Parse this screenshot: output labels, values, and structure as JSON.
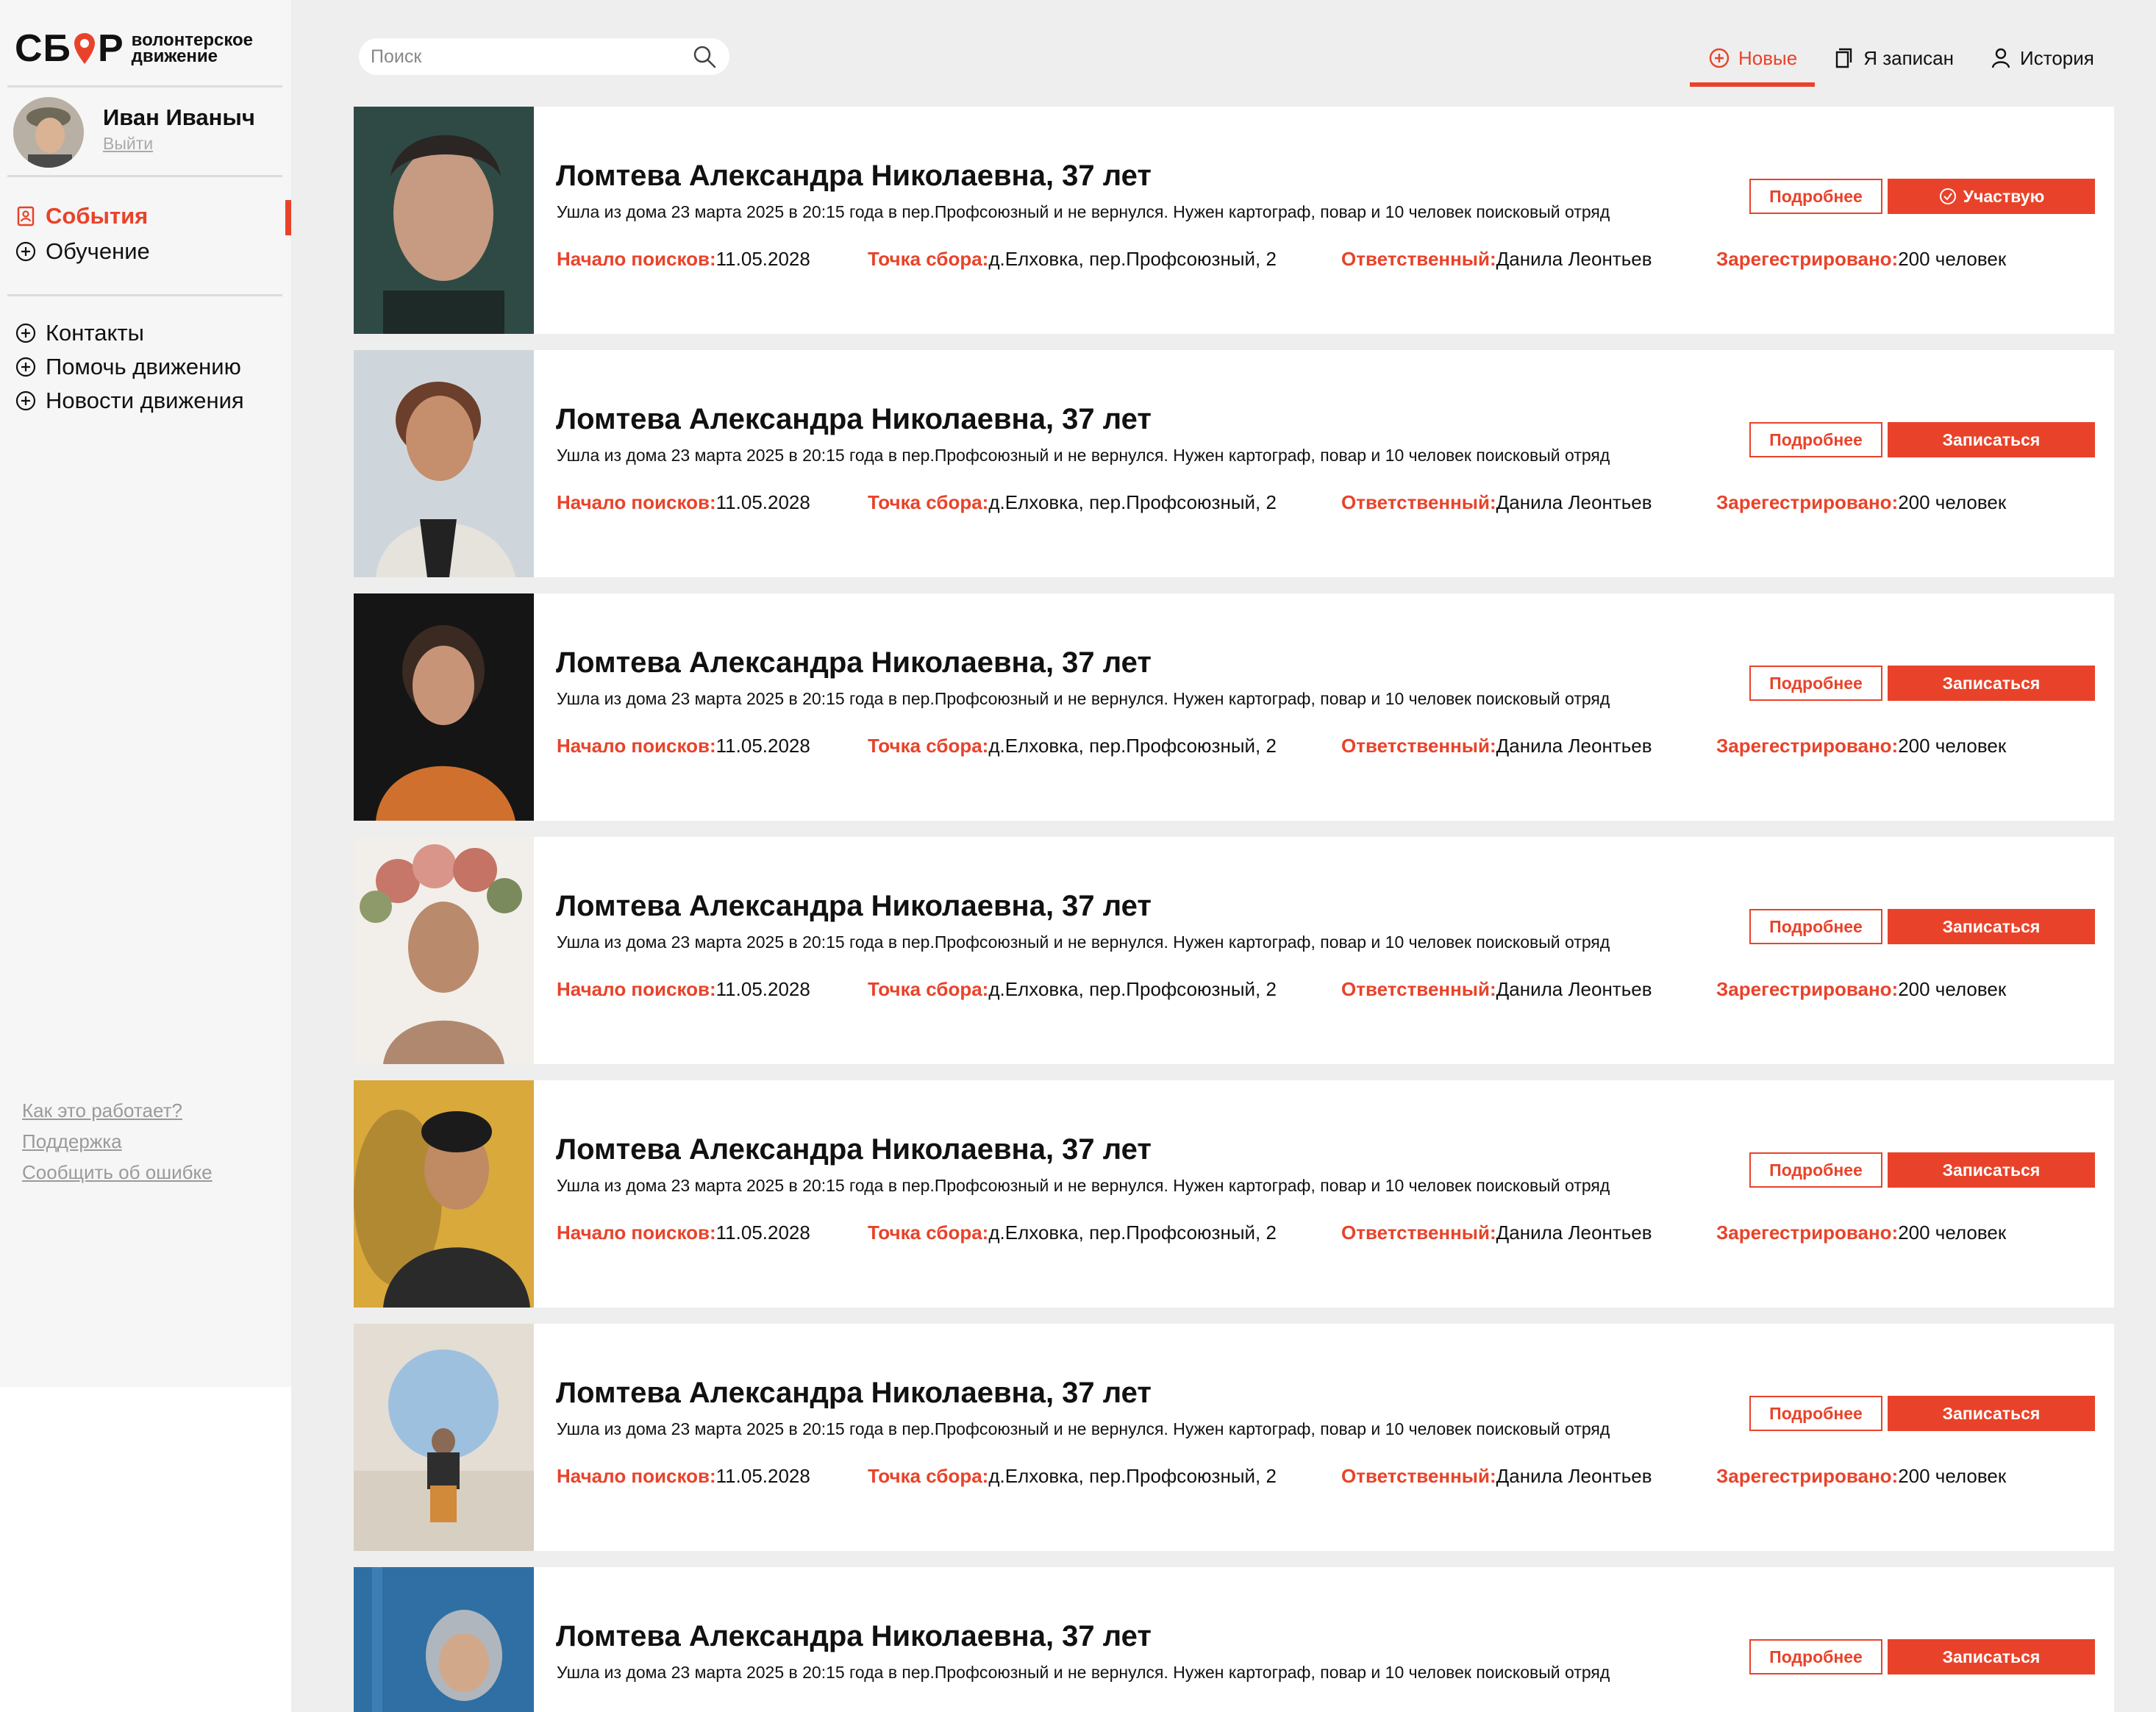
{
  "brand": {
    "logo_left": "СБ",
    "logo_right": "Р",
    "logo_sub_1": "волонтерское",
    "logo_sub_2": "движение",
    "accent": "#e8432a"
  },
  "user": {
    "name": "Иван Иваныч",
    "logout": "Выйти"
  },
  "nav_main": [
    {
      "label": "События",
      "icon": "events-icon",
      "active": true
    },
    {
      "label": "Обучение",
      "icon": "plus-circle-icon",
      "active": false
    }
  ],
  "nav_secondary": [
    {
      "label": "Контакты",
      "icon": "plus-circle-icon"
    },
    {
      "label": "Помочь движению",
      "icon": "plus-circle-icon"
    },
    {
      "label": "Новости движения",
      "icon": "plus-circle-icon"
    }
  ],
  "footer_links": [
    "Как это работает?",
    "Поддержка",
    "Сообщить об ошибке"
  ],
  "search": {
    "placeholder": "Поиск"
  },
  "tabs": [
    {
      "label": "Новые",
      "icon": "plus-circle-icon",
      "active": true
    },
    {
      "label": "Я записан",
      "icon": "document-icon",
      "active": false
    },
    {
      "label": "История",
      "icon": "user-icon",
      "active": false
    }
  ],
  "labels": {
    "start": "Начало поисков:",
    "point": "Точка сбора:",
    "responsible": "Ответственный:",
    "registered": "Зарегестрировано:",
    "more": "Подробнее",
    "join": "Записаться",
    "joined": "Участвую"
  },
  "cards": [
    {
      "title": "Ломтева Александра Николаевна, 37 лет",
      "desc": "Ушла из дома 23 марта 2025 в 20:15 года в пер.Профсоюзный и не вернулся. Нужен картограф, повар и 10 человек поисковый отряд",
      "start": "11.05.2028",
      "point": "д.Елховка, пер.Профсоюзный, 2",
      "responsible": "Данила Леонтьев",
      "registered": "200 человек",
      "status": "joined"
    },
    {
      "title": "Ломтева Александра Николаевна, 37 лет",
      "desc": "Ушла из дома 23 марта 2025 в 20:15 года в пер.Профсоюзный и не вернулся. Нужен картограф, повар и 10 человек поисковый отряд",
      "start": "11.05.2028",
      "point": "д.Елховка, пер.Профсоюзный, 2",
      "responsible": "Данила Леонтьев",
      "registered": "200 человек",
      "status": "join"
    },
    {
      "title": "Ломтева Александра Николаевна, 37 лет",
      "desc": "Ушла из дома 23 марта 2025 в 20:15 года в пер.Профсоюзный и не вернулся. Нужен картограф, повар и 10 человек поисковый отряд",
      "start": "11.05.2028",
      "point": "д.Елховка, пер.Профсоюзный, 2",
      "responsible": "Данила Леонтьев",
      "registered": "200 человек",
      "status": "join"
    },
    {
      "title": "Ломтева Александра Николаевна, 37 лет",
      "desc": "Ушла из дома 23 марта 2025 в 20:15 года в пер.Профсоюзный и не вернулся. Нужен картограф, повар и 10 человек поисковый отряд",
      "start": "11.05.2028",
      "point": "д.Елховка, пер.Профсоюзный, 2",
      "responsible": "Данила Леонтьев",
      "registered": "200 человек",
      "status": "join"
    },
    {
      "title": "Ломтева Александра Николаевна, 37 лет",
      "desc": "Ушла из дома 23 марта 2025 в 20:15 года в пер.Профсоюзный и не вернулся. Нужен картограф, повар и 10 человек поисковый отряд",
      "start": "11.05.2028",
      "point": "д.Елховка, пер.Профсоюзный, 2",
      "responsible": "Данила Леонтьев",
      "registered": "200 человек",
      "status": "join"
    },
    {
      "title": "Ломтева Александра Николаевна, 37 лет",
      "desc": "Ушла из дома 23 марта 2025 в 20:15 года в пер.Профсоюзный и не вернулся. Нужен картограф, повар и 10 человек поисковый отряд",
      "start": "11.05.2028",
      "point": "д.Елховка, пер.Профсоюзный, 2",
      "responsible": "Данила Леонтьев",
      "registered": "200 человек",
      "status": "join"
    },
    {
      "title": "Ломтева Александра Николаевна, 37 лет",
      "desc": "Ушла из дома 23 марта 2025 в 20:15 года в пер.Профсоюзный и не вернулся. Нужен картограф, повар и 10 человек поисковый отряд",
      "start": "",
      "point": "",
      "responsible": "",
      "registered": "",
      "status": "join"
    }
  ]
}
